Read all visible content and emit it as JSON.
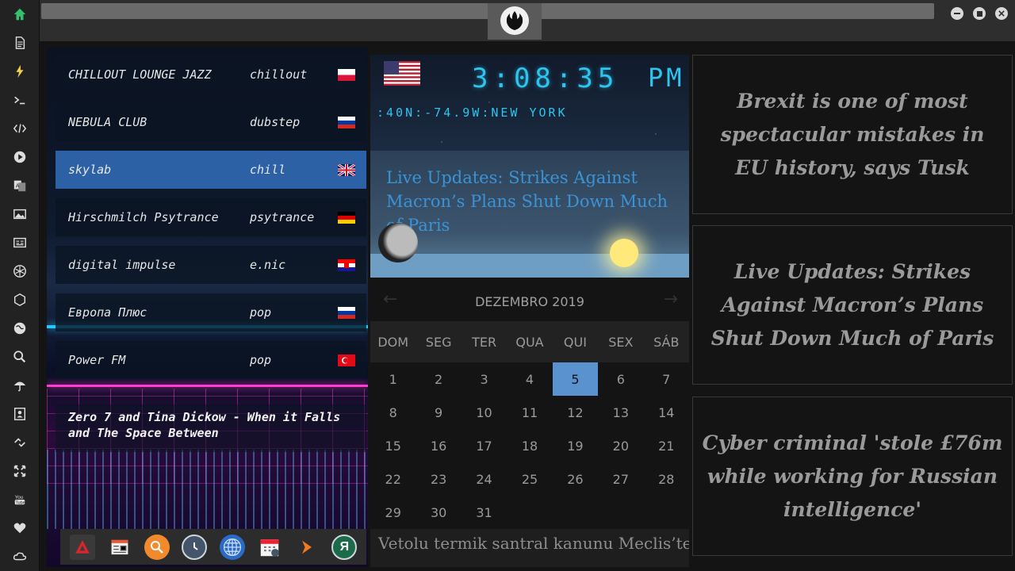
{
  "sidebar": {
    "icons": [
      "home-icon",
      "document-icon",
      "lightning-icon",
      "terminal-icon",
      "code-icon",
      "play-icon",
      "translate-icon",
      "image-icon",
      "news-icon",
      "rebel-icon",
      "hexagon-icon",
      "globe-icon",
      "search-icon",
      "umbrella-icon",
      "contacts-icon",
      "link-icon",
      "expand-icon",
      "youtube-icon",
      "heart-icon",
      "cloud-icon"
    ]
  },
  "window": {
    "logo": "rebel-alliance-logo"
  },
  "radio": {
    "stations": [
      {
        "name": "CHILLOUT LOUNGE JAZZ",
        "genre": "chillout",
        "flag": "poland"
      },
      {
        "name": "NEBULA CLUB",
        "genre": "dubstep",
        "flag": "russia"
      },
      {
        "name": "skylab",
        "genre": "chill",
        "flag": "uk"
      },
      {
        "name": "Hirschmilch Psytrance",
        "genre": "psytrance",
        "flag": "germany"
      },
      {
        "name": "digital impulse",
        "genre": "e.nic",
        "flag": "croatia"
      },
      {
        "name": "Европа Плюс",
        "genre": "pop",
        "flag": "russia"
      },
      {
        "name": "Power FM",
        "genre": "pop",
        "flag": "turkey"
      }
    ],
    "active_station": "skylab",
    "now_playing": "Zero 7 and Tina Dickow - When it Falls and The Space Between"
  },
  "dock": {
    "apps": [
      "artix-app",
      "news-reader-app",
      "search-app",
      "clock-app",
      "browser-app",
      "calendar-app",
      "forward-app",
      "yandex-app"
    ]
  },
  "clock": {
    "time": "3:08:35",
    "ampm": "PM",
    "location": ":40N:-74.9W:NEW YORK",
    "flag": "usa",
    "headline": "Live Updates: Strikes Against Macron’s Plans Shut Down Much of Paris"
  },
  "calendar": {
    "month": "DEZEMBRO 2019",
    "weekdays": [
      "DOM",
      "SEG",
      "TER",
      "QUA",
      "QUI",
      "SEX",
      "SÁB"
    ],
    "days": [
      "1",
      "2",
      "3",
      "4",
      "5",
      "6",
      "7",
      "8",
      "9",
      "10",
      "11",
      "12",
      "13",
      "14",
      "15",
      "16",
      "17",
      "18",
      "19",
      "20",
      "21",
      "22",
      "23",
      "24",
      "25",
      "26",
      "27",
      "28",
      "29",
      "30",
      "31"
    ],
    "today": "5"
  },
  "ticker": {
    "text": "Vetolu termik santral kanunu Meclis’ten"
  },
  "news": [
    "Brexit is one of most spectacular mistakes in EU history, says Tusk",
    "Live Updates: Strikes Against Macron’s Plans Shut Down Much of Paris",
    "Cyber criminal 'stole £76m while working for Russian intelligence'"
  ],
  "colors": {
    "accent": "#2ec4f0",
    "active_station": "#2d61a6",
    "today": "#5a92cf"
  }
}
